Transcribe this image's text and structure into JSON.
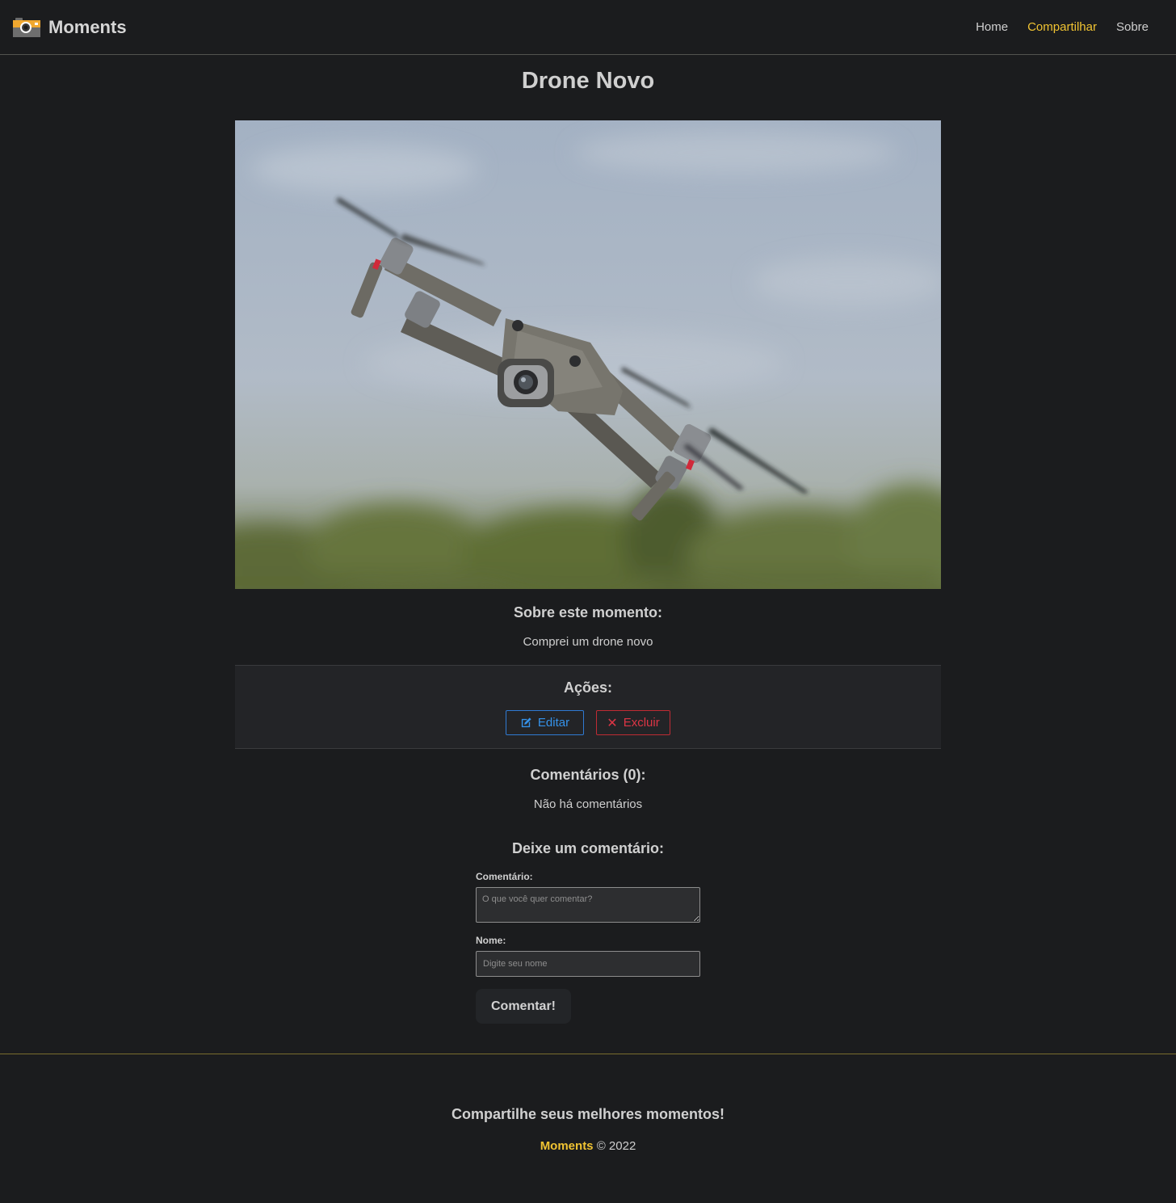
{
  "navbar": {
    "brand_name": "Moments",
    "links": [
      "Home",
      "Compartilhar",
      "Sobre"
    ],
    "accent_color": "#f0c332"
  },
  "moment": {
    "title": "Drone Novo",
    "image_alt": "drone",
    "about_title": "Sobre este momento:",
    "description": "Comprei um drone novo"
  },
  "actions": {
    "title": "Ações:",
    "edit_label": "Editar",
    "delete_label": "Excluir",
    "edit_icon": "edit-icon",
    "delete_icon": "close-icon"
  },
  "comments": {
    "title": "Comentários (0):",
    "empty_text": "Não há comentários"
  },
  "comment_form": {
    "title": "Deixe um comentário:",
    "comment_label": "Comentário:",
    "comment_placeholder": "O que você quer comentar?",
    "name_label": "Nome:",
    "name_placeholder": "Digite seu nome",
    "submit_label": "Comentar!"
  },
  "footer": {
    "tagline": "Compartilhe seus melhores momentos!",
    "brand": "Moments",
    "copyright": "© 2022"
  }
}
